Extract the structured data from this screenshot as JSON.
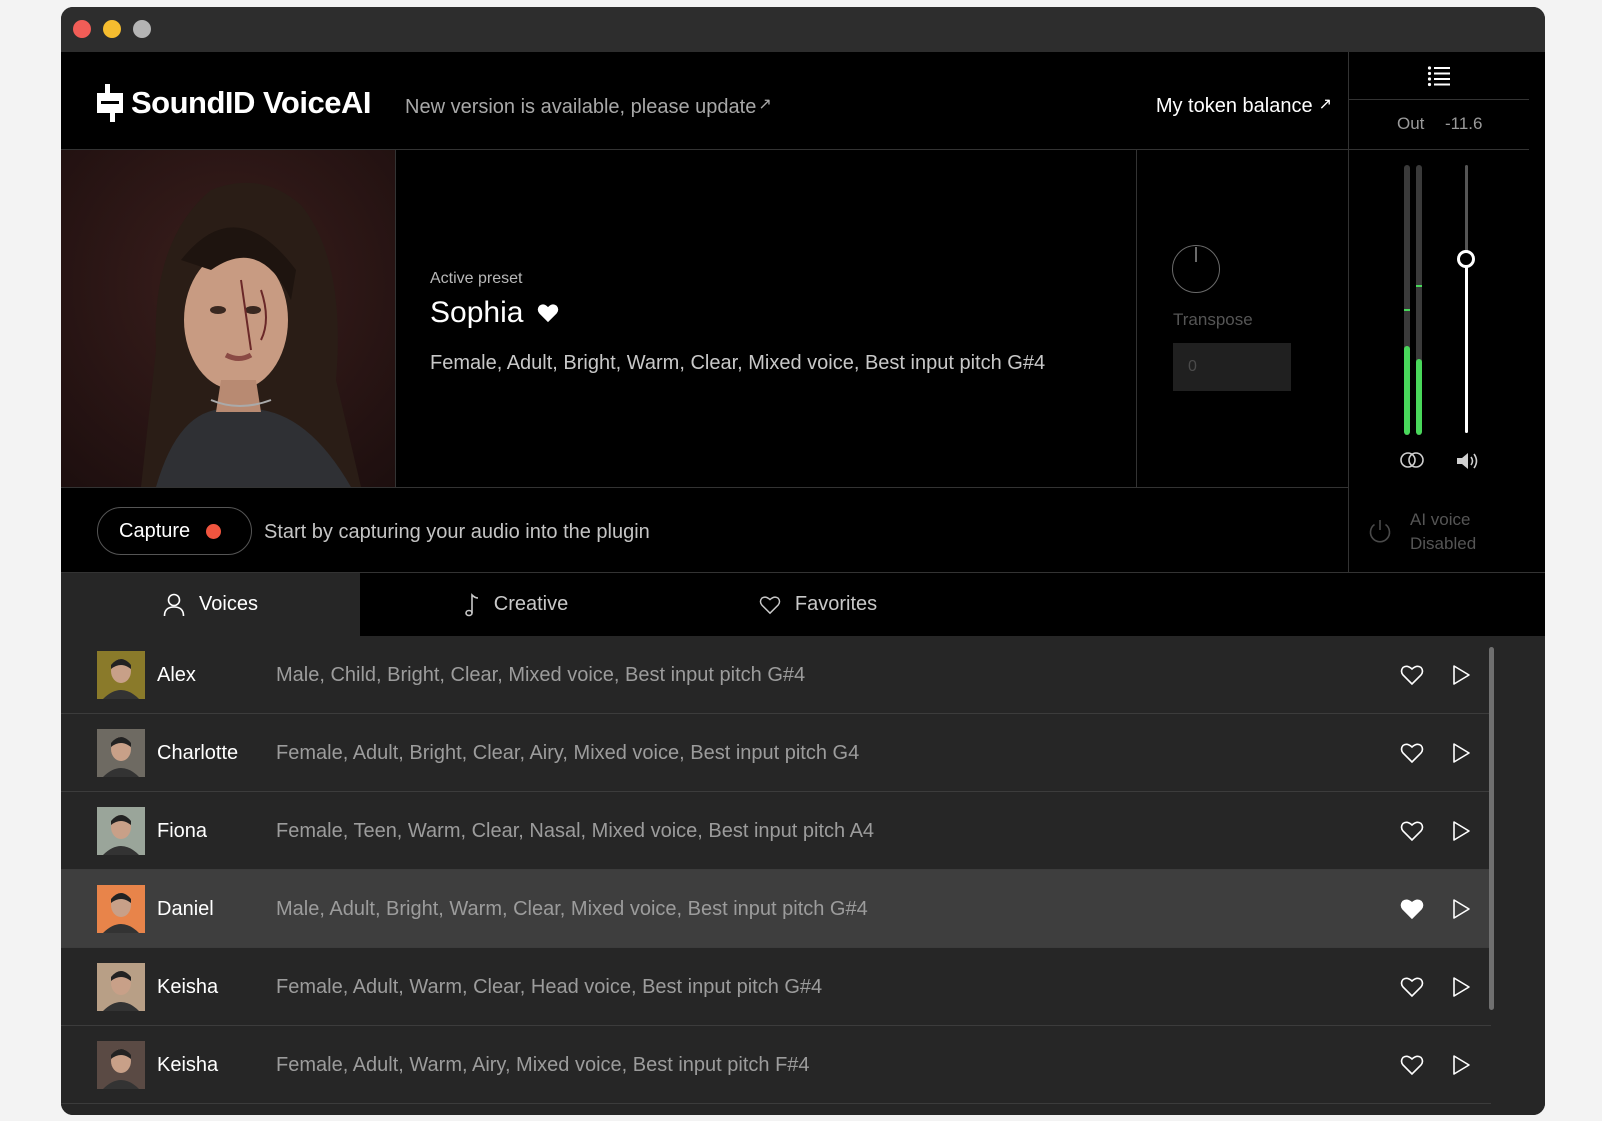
{
  "app": {
    "title": "SoundID VoiceAI",
    "update_notice": "New version is available, please update",
    "token_balance_label": "My token balance"
  },
  "output": {
    "label": "Out",
    "value": "-11.6",
    "meter_left_level": 0.33,
    "meter_right_level": 0.28,
    "meter_left_peak": 0.46,
    "meter_right_peak": 0.55,
    "fader_level": 0.65
  },
  "preset": {
    "label": "Active preset",
    "name": "Sophia",
    "favorite": true,
    "tags": "Female, Adult, Bright, Warm, Clear, Mixed voice, Best input pitch  G#4"
  },
  "transpose": {
    "label": "Transpose",
    "value": "0"
  },
  "capture": {
    "button_label": "Capture",
    "hint": "Start by capturing your audio into the plugin"
  },
  "ai_voice": {
    "title": "AI voice",
    "state": "Disabled"
  },
  "tabs": [
    {
      "label": "Voices",
      "icon": "person-icon",
      "active": true
    },
    {
      "label": "Creative",
      "icon": "music-note-icon",
      "active": false
    },
    {
      "label": "Favorites",
      "icon": "heart-outline-icon",
      "active": false
    }
  ],
  "voices": [
    {
      "name": "Alex",
      "tags": "Male, Child, Bright, Clear, Mixed voice, Best input pitch G#4",
      "favorite": false,
      "thumb_color": "#8a7a2a"
    },
    {
      "name": "Charlotte",
      "tags": "Female, Adult, Bright, Clear, Airy, Mixed voice, Best input pitch  G4",
      "favorite": false,
      "thumb_color": "#6e6a62"
    },
    {
      "name": "Fiona",
      "tags": "Female, Teen, Warm, Clear, Nasal, Mixed voice, Best input pitch  A4",
      "favorite": false,
      "thumb_color": "#9aa59a"
    },
    {
      "name": "Daniel",
      "tags": "Male, Adult, Bright, Warm, Clear, Mixed voice, Best input pitch  G#4",
      "favorite": true,
      "thumb_color": "#e8844a"
    },
    {
      "name": "Keisha",
      "tags": "Female, Adult, Warm, Clear, Head voice, Best input pitch  G#4",
      "favorite": false,
      "thumb_color": "#b89f86"
    },
    {
      "name": "Keisha",
      "tags": "Female, Adult, Warm, Airy, Mixed voice, Best input pitch  F#4",
      "favorite": false,
      "thumb_color": "#5a4a44"
    }
  ],
  "colors": {
    "accent_green": "#49d85b",
    "record_red": "#f0553f",
    "background": "#000000",
    "list_background": "#262626"
  }
}
